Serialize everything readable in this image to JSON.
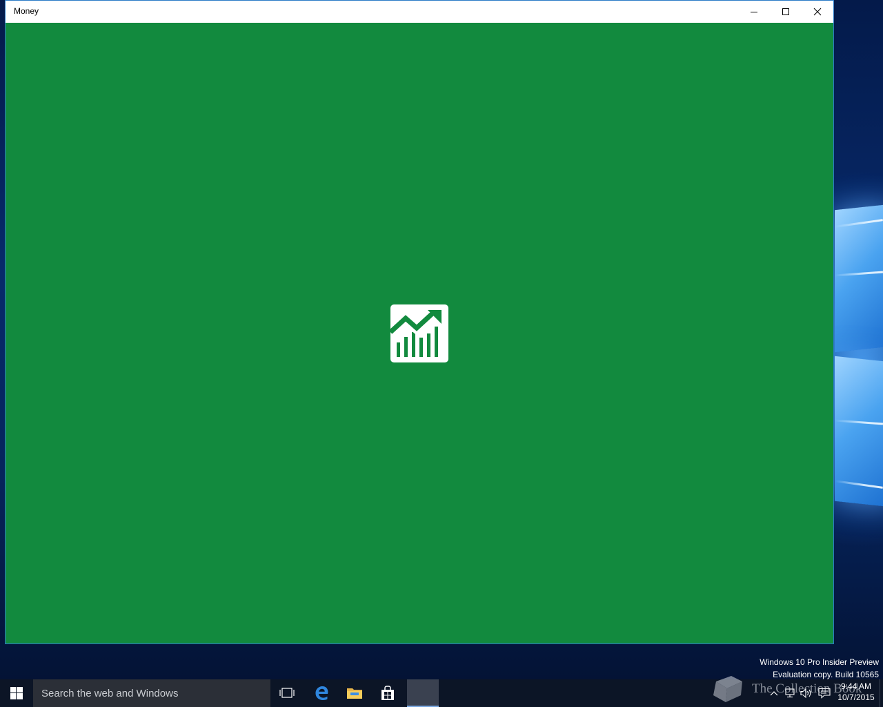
{
  "window": {
    "title": "Money",
    "accent_color": "#128a3e"
  },
  "caption_buttons": {
    "minimize_icon": "minimize-icon",
    "maximize_icon": "maximize-icon",
    "close_icon": "close-icon"
  },
  "splash": {
    "icon": "money-chart-icon"
  },
  "watermark": {
    "line1": "Windows 10 Pro Insider Preview",
    "line2": "Evaluation copy. Build 10565"
  },
  "taskbar": {
    "search_placeholder": "Search the web and Windows",
    "clock_time": "9:44 AM",
    "clock_date": "10/7/2015",
    "watermark_logo_text": "The Collection Book"
  }
}
